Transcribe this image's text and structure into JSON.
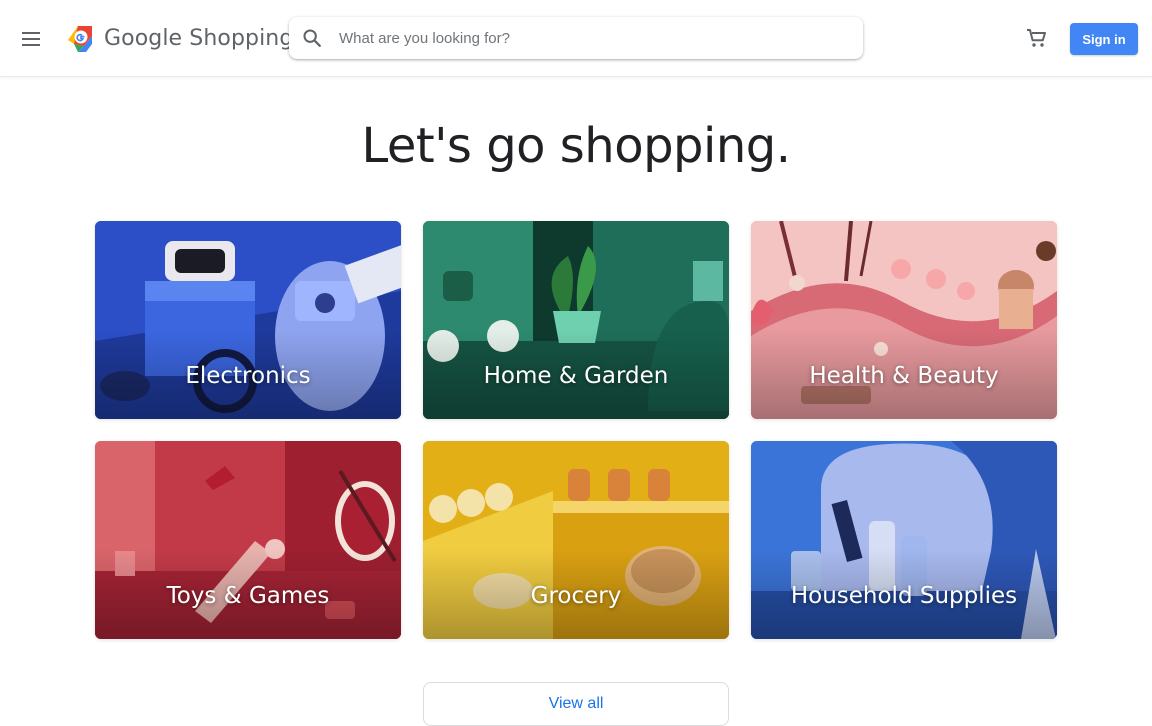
{
  "header": {
    "brand": "Google Shopping",
    "search_placeholder": "What are you looking for?",
    "search_value": "",
    "sign_in_label": "Sign in",
    "icons": {
      "menu": "hamburger-menu-icon",
      "logo": "google-shopping-logo",
      "search": "search-icon",
      "cart": "shopping-cart-icon"
    }
  },
  "hero": {
    "title": "Let's go shopping."
  },
  "categories": [
    {
      "label": "Electronics",
      "color": "#2548b8"
    },
    {
      "label": "Home & Garden",
      "color": "#1f6e5a"
    },
    {
      "label": "Health & Beauty",
      "color": "#e9a3a6"
    },
    {
      "label": "Toys & Games",
      "color": "#b3283a"
    },
    {
      "label": "Grocery",
      "color": "#d9a719"
    },
    {
      "label": "Household Supplies",
      "color": "#2a5fc4"
    }
  ],
  "view_all_label": "View all",
  "colors": {
    "accent": "#4285f4",
    "link": "#1a73e8"
  }
}
